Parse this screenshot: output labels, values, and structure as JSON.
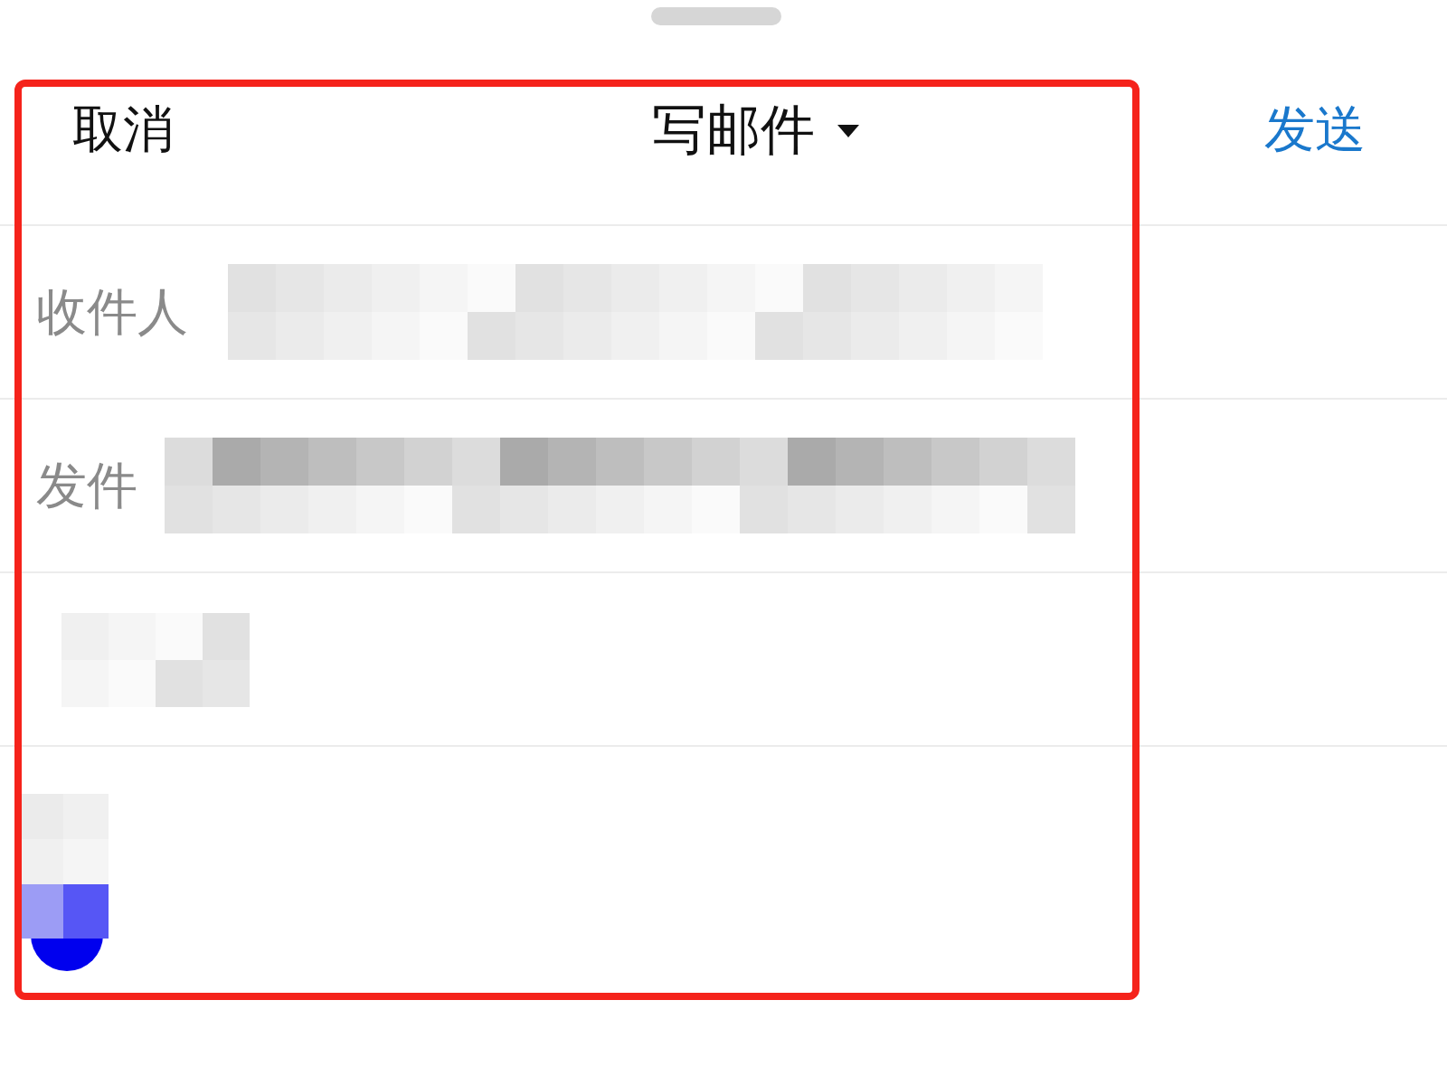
{
  "header": {
    "cancel": "取消",
    "title": "写邮件",
    "send": "发送"
  },
  "fields": [
    {
      "label": "收件人"
    },
    {
      "label": "发件"
    }
  ]
}
